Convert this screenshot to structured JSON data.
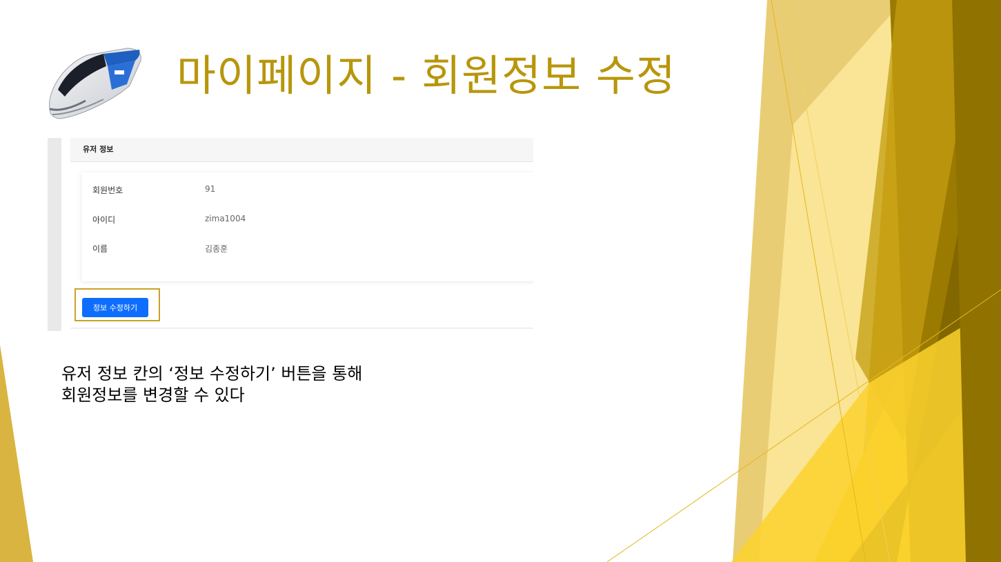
{
  "slide": {
    "title": "마이페이지 - 회원정보 수정",
    "title_color": "#B8960C",
    "caption_lines": [
      "유저 정보 칸의 ‘정보 수정하기’ 버튼을 통해",
      "회원정보를 변경할 수 있다"
    ]
  },
  "screenshot": {
    "section_title": "유저 정보",
    "rows": [
      {
        "label": "회원번호",
        "value": "91"
      },
      {
        "label": "아이디",
        "value": "zima1004"
      },
      {
        "label": "이름",
        "value": "김종훈"
      }
    ],
    "edit_button_label": "정보 수정하기",
    "button_color": "#0D6EFD",
    "highlight_color": "#C9A227"
  },
  "train_logo": {
    "icon": "ktx-train-icon"
  },
  "theme": {
    "accent_colors": [
      "#D4A920",
      "#F5C518",
      "#FFE78A",
      "#8C7000",
      "#E4C35A"
    ]
  }
}
